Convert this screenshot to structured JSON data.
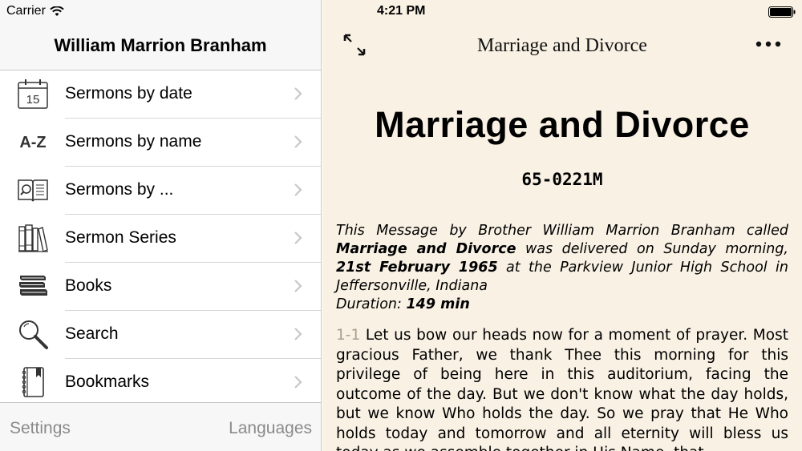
{
  "status_bar": {
    "carrier": "Carrier",
    "time": "4:21 PM"
  },
  "master": {
    "title": "William Marrion Branham",
    "items": [
      {
        "label": "Sermons by date",
        "icon": "calendar-icon",
        "calendar_day": "15"
      },
      {
        "label": "Sermons by name",
        "icon": "a-z-icon",
        "icon_text": "A-Z"
      },
      {
        "label": "Sermons by ...",
        "icon": "book-search-icon"
      },
      {
        "label": "Sermon Series",
        "icon": "bookshelf-icon"
      },
      {
        "label": "Books",
        "icon": "books-stack-icon"
      },
      {
        "label": "Search",
        "icon": "magnifier-icon"
      },
      {
        "label": "Bookmarks",
        "icon": "bookmark-book-icon"
      }
    ],
    "footer": {
      "settings": "Settings",
      "languages": "Languages"
    }
  },
  "detail": {
    "nav_title": "Marriage and Divorce",
    "title": "Marriage and Divorce",
    "code": "65-0221M",
    "intro": {
      "part1": "This Message by Brother William Marrion Branham called ",
      "sermon_name": "Marriage and Divorce",
      "part2": " was delivered on Sunday morning, ",
      "date": "21st February 1965",
      "part3": " at the Parkview Junior High School in Jeffersonville, Indiana",
      "duration_label": "Duration: ",
      "duration_value": "149 min"
    },
    "paragraph": {
      "number": "1-1",
      "text": "Let us bow our heads now for a moment of prayer. Most gracious Father, we thank Thee this morning for this privilege of being here in this auditorium, facing the outcome of the day. But we don't know what the day holds, but we know Who holds the day. So we pray that He Who holds today and tomorrow and all eternity will bless us today as we assemble together in His Name, that"
    }
  },
  "colors": {
    "detail_background": "#f8f1e4",
    "header_background": "#f7f7f7",
    "footer_text": "#8a8a8a",
    "paragraph_number": "#a99e8c"
  }
}
